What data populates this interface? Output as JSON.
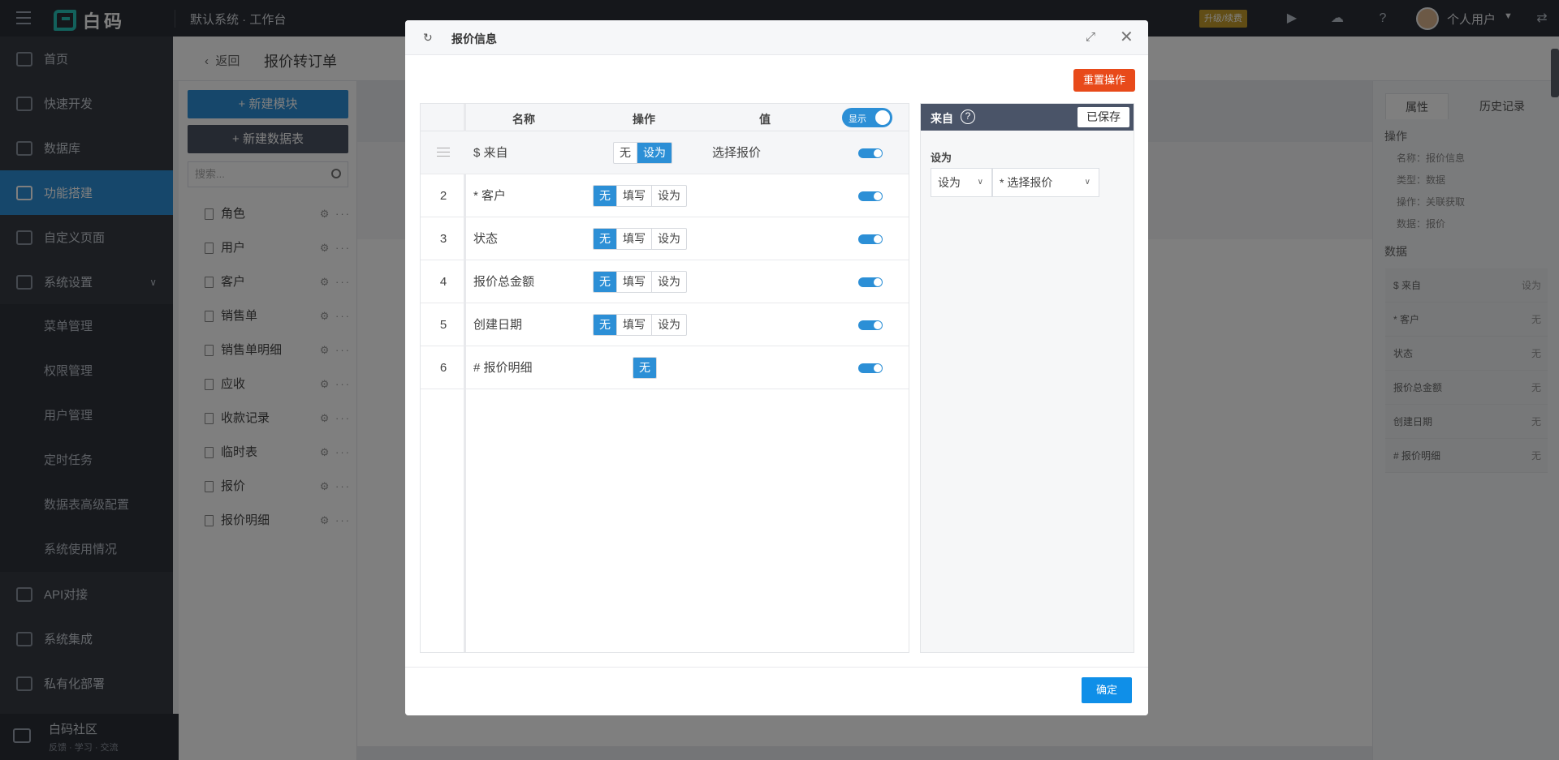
{
  "topbar": {
    "logo_text": "白码",
    "title": "默认系统 · 工作台",
    "upgrade_label": "升级/续费",
    "user_name": "个人用户"
  },
  "sidebar": {
    "items": [
      {
        "label": "首页",
        "icon": "home-icon"
      },
      {
        "label": "快速开发",
        "icon": "cube-icon"
      },
      {
        "label": "数据库",
        "icon": "database-icon"
      },
      {
        "label": "功能搭建",
        "icon": "build-icon"
      },
      {
        "label": "自定义页面",
        "icon": "page-icon"
      },
      {
        "label": "系统设置",
        "icon": "settings-icon"
      }
    ],
    "subitems": [
      "菜单管理",
      "权限管理",
      "用户管理",
      "定时任务",
      "数据表高级配置",
      "系统使用情况"
    ],
    "lower_items": [
      {
        "label": "API对接",
        "icon": "api-icon"
      },
      {
        "label": "系统集成",
        "icon": "layers-icon"
      },
      {
        "label": "私有化部署",
        "icon": "lock-icon"
      }
    ],
    "community": {
      "title": "白码社区",
      "subtitle": "反馈 · 学习 · 交流"
    }
  },
  "main": {
    "back_label": "返回",
    "page_title": "报价转订单",
    "new_module_label": "+ 新建模块",
    "new_table_label": "+ 新建数据表",
    "search_placeholder": "搜索...",
    "tables": [
      "角色",
      "用户",
      "客户",
      "销售单",
      "销售单明细",
      "应收",
      "收款记录",
      "临时表",
      "报价",
      "报价明细"
    ]
  },
  "right_panel": {
    "tabs": [
      "属性",
      "历史记录"
    ],
    "section_ops": "操作",
    "props": [
      "名称：报价信息",
      "类型：数据",
      "操作：关联获取",
      "数据：报价"
    ],
    "section_data": "数据",
    "rows": [
      {
        "name": "$ 来自",
        "value": "设为"
      },
      {
        "name": "* 客户",
        "value": "无"
      },
      {
        "name": "状态",
        "value": "无"
      },
      {
        "name": "报价总金额",
        "value": "无"
      },
      {
        "name": "创建日期",
        "value": "无"
      },
      {
        "name": "# 报价明细",
        "value": "无"
      }
    ]
  },
  "modal": {
    "title": "报价信息",
    "reset_label": "重置操作",
    "confirm_label": "确定",
    "table": {
      "headers": {
        "name": "名称",
        "op": "操作",
        "value": "值",
        "show": "显示"
      },
      "rows": [
        {
          "index": "",
          "name": "$ 来自",
          "value": "选择报价"
        },
        {
          "index": "2",
          "name": "* 客户",
          "value": ""
        },
        {
          "index": "3",
          "name": "状态",
          "value": ""
        },
        {
          "index": "4",
          "name": "报价总金额",
          "value": ""
        },
        {
          "index": "5",
          "name": "创建日期",
          "value": ""
        },
        {
          "index": "6",
          "name": "# 报价明细",
          "value": ""
        }
      ],
      "op_labels": {
        "none": "无",
        "fill": "填写",
        "set": "设为"
      }
    },
    "side": {
      "title": "来自",
      "saved_label": "已保存",
      "field_label": "设为",
      "select1": "设为",
      "select2": "* 选择报价"
    }
  }
}
